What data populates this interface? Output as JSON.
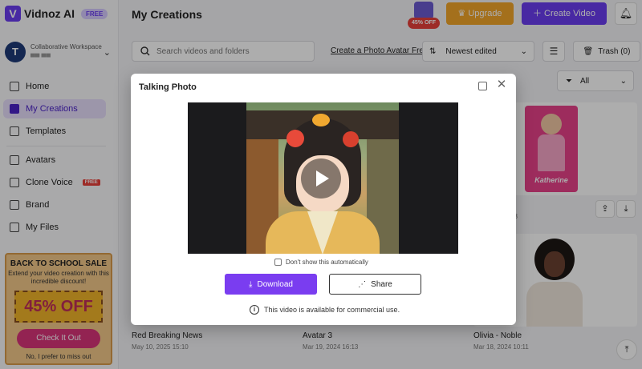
{
  "app": {
    "name": "Vidnoz AI",
    "plan_badge": "FREE"
  },
  "workspace": {
    "label": "Collaborative Workspace",
    "avatar_letter": "T",
    "sub": "▀▀ ▀▀"
  },
  "sidebar": {
    "items": [
      {
        "label": "Home"
      },
      {
        "label": "My Creations",
        "active": true
      },
      {
        "label": "Templates"
      },
      {
        "label": "Avatars"
      },
      {
        "label": "Clone Voice",
        "badge": "FREE"
      },
      {
        "label": "Brand"
      },
      {
        "label": "My Files"
      }
    ]
  },
  "promo": {
    "title": "BACK TO SCHOOL SALE",
    "subtitle": "Extend your video creation with this incredible discount!",
    "discount": "45% OFF",
    "cta": "Check It Out",
    "dismiss": "No, I prefer to miss out"
  },
  "header": {
    "title": "My Creations",
    "sale_badge": "45% OFF",
    "upgrade_label": "Upgrade",
    "create_label": "Create Video"
  },
  "toolbar": {
    "search_placeholder": "Search videos and folders",
    "photo_avatar_link": "Create a Photo Avatar Free",
    "sort_label": "Newest edited",
    "trash_label": "Trash (0)",
    "filter_label": "All"
  },
  "cards": [
    {
      "title": "Red Breaking News",
      "date": "May 10, 2025 15:10"
    },
    {
      "title": "Avatar 3",
      "date": "Mar 19, 2024 16:13"
    },
    {
      "title": "Olivia - Noble",
      "date": "Mar 18, 2024 10:11"
    }
  ],
  "partial_card": {
    "title_fragment": "o",
    "date_fragment": "43",
    "thumb_name": "Katherine"
  },
  "modal": {
    "title": "Talking Photo",
    "dont_show_label": "Don't show this automatically",
    "download_label": "Download",
    "share_label": "Share",
    "commercial_note": "This video is available for commercial use."
  },
  "colors": {
    "brand": "#6b3df0",
    "upgrade": "#f2a52a",
    "download": "#7a3df0"
  }
}
